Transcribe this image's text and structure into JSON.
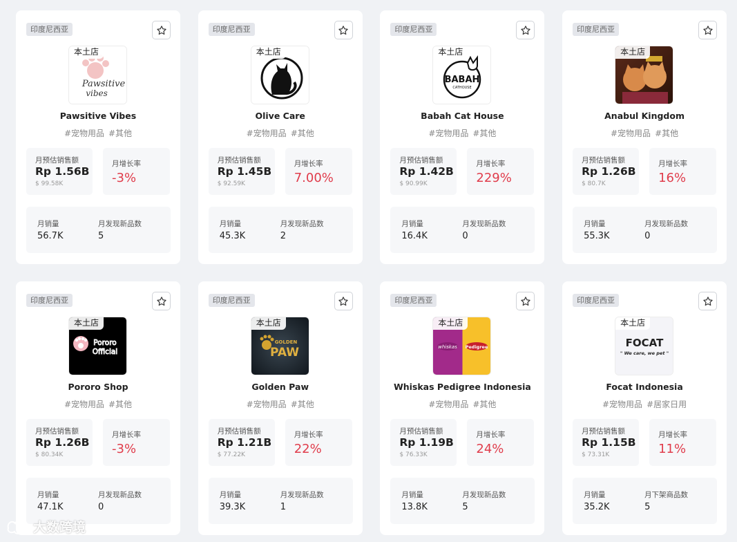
{
  "labels": {
    "region": "印度尼西亚",
    "local_store": "本土店",
    "revenue": "月预估销售额",
    "growth": "月增长率",
    "sales": "月销量",
    "new_products": "月发现新品数",
    "delisted_products": "月下架商品数"
  },
  "stores": [
    {
      "name": "Pawsitive Vibes",
      "tags": [
        "#宠物用品",
        "#其他"
      ],
      "revenue": "Rp 1.56B",
      "revenue_usd": "$ 99.58K",
      "growth": "-3%",
      "sales": "56.7K",
      "metric2_label": "月发现新品数",
      "metric2_value": "5",
      "logo_text": [
        "Pawsitive",
        "vibes"
      ]
    },
    {
      "name": "Olive Care",
      "tags": [
        "#宠物用品",
        "#其他"
      ],
      "revenue": "Rp 1.45B",
      "revenue_usd": "$ 92.59K",
      "growth": "7.00%",
      "sales": "45.3K",
      "metric2_label": "月发现新品数",
      "metric2_value": "2"
    },
    {
      "name": "Babah Cat House",
      "tags": [
        "#宠物用品",
        "#其他"
      ],
      "revenue": "Rp 1.42B",
      "revenue_usd": "$ 90.99K",
      "growth": "229%",
      "sales": "16.4K",
      "metric2_label": "月发现新品数",
      "metric2_value": "0",
      "logo_text": [
        "BABAH",
        "CATHOUSE"
      ]
    },
    {
      "name": "Anabul Kingdom",
      "tags": [
        "#宠物用品",
        "#其他"
      ],
      "revenue": "Rp 1.26B",
      "revenue_usd": "$ 80.7K",
      "growth": "16%",
      "sales": "55.3K",
      "metric2_label": "月发现新品数",
      "metric2_value": "0"
    },
    {
      "name": "Pororo Shop",
      "tags": [
        "#宠物用品",
        "#其他"
      ],
      "revenue": "Rp 1.26B",
      "revenue_usd": "$ 80.34K",
      "growth": "-3%",
      "sales": "47.1K",
      "metric2_label": "月发现新品数",
      "metric2_value": "0",
      "logo_text": [
        "Pororo",
        "Official"
      ]
    },
    {
      "name": "Golden Paw",
      "tags": [
        "#宠物用品",
        "#其他"
      ],
      "revenue": "Rp 1.21B",
      "revenue_usd": "$ 77.22K",
      "growth": "22%",
      "sales": "39.3K",
      "metric2_label": "月发现新品数",
      "metric2_value": "1",
      "logo_text": [
        "GOLDEN",
        "PAW"
      ]
    },
    {
      "name": "Whiskas Pedigree Indonesia",
      "tags": [
        "#宠物用品",
        "#其他"
      ],
      "revenue": "Rp 1.19B",
      "revenue_usd": "$ 76.33K",
      "growth": "24%",
      "sales": "13.8K",
      "metric2_label": "月发现新品数",
      "metric2_value": "5",
      "logo_text": [
        "whiskas",
        "Pedigree"
      ]
    },
    {
      "name": "Focat Indonesia",
      "tags": [
        "#宠物用品",
        "#居家日用"
      ],
      "revenue": "Rp 1.15B",
      "revenue_usd": "$ 73.31K",
      "growth": "11%",
      "sales": "35.2K",
      "metric2_label": "月下架商品数",
      "metric2_value": "5",
      "logo_text": [
        "FOCAT",
        "\" We care, we pet \""
      ]
    }
  ],
  "watermark": "大数跨境",
  "colors": {
    "growth": "#e03c4b",
    "background": "#f0f2f5"
  },
  "icons": {
    "favorite": "star-icon"
  }
}
